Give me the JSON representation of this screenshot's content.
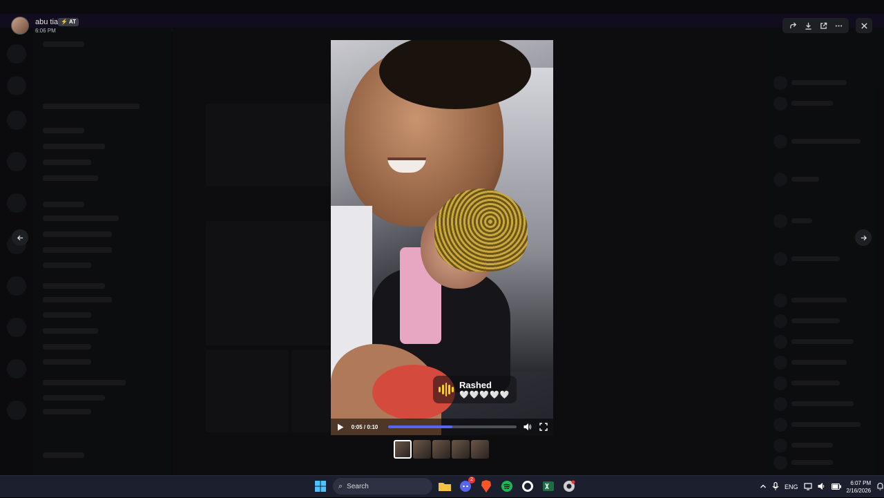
{
  "viewer": {
    "author_name": "abu tia",
    "author_tag": "⚡ AT",
    "timestamp": "6:06 PM",
    "actions": {
      "forward_icon": "forward-icon",
      "download_icon": "download-icon",
      "open_external_icon": "external-link-icon",
      "more_icon": "more-icon",
      "close_icon": "close-icon"
    }
  },
  "video": {
    "caption_name": "Rashed",
    "caption_hearts": "🤍🤍🤍🤍🤍",
    "time_display": "0:05 / 0:10",
    "progress": 0.5,
    "accent_color": "#5865f2"
  },
  "thumbnails": {
    "count": 5,
    "active_index": 0
  },
  "taskbar": {
    "search_label": "Search",
    "discord_badge": "2",
    "language": "ENG",
    "time": "6:07 PM",
    "date": "2/16/2026"
  }
}
